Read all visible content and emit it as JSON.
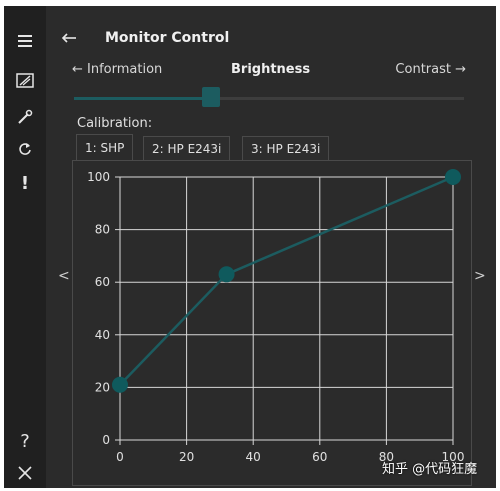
{
  "header": {
    "title": "Monitor Control"
  },
  "nav": {
    "prev_label": "← Information",
    "current_label": "Brightness",
    "next_label": "Contrast →"
  },
  "slider": {
    "value_fraction": 0.35
  },
  "calibration": {
    "label": "Calibration:",
    "tabs": [
      {
        "label": "1: SHP",
        "active": true
      },
      {
        "label": "2: HP E243i",
        "active": false
      },
      {
        "label": "3: HP E243i",
        "active": false
      }
    ]
  },
  "chart_data": {
    "type": "line",
    "x": [
      0,
      32,
      100
    ],
    "series": [
      {
        "values": [
          21,
          63,
          100
        ]
      }
    ],
    "xlim": [
      0,
      100
    ],
    "ylim": [
      0,
      100
    ],
    "xticks": [
      0,
      20,
      40,
      60,
      80,
      100
    ],
    "yticks": [
      0,
      20,
      40,
      60,
      80,
      100
    ],
    "grid": true,
    "line_color": "#1c5c60",
    "point_color": "#0f5a5d"
  },
  "colors": {
    "accent": "#1c5c60",
    "background": "#2b2b2b",
    "sidebar": "#202020"
  },
  "watermark": "知乎 @代码狂魔"
}
